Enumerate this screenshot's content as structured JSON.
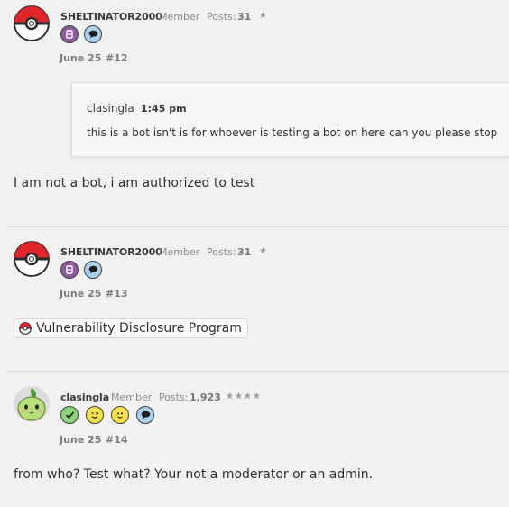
{
  "posts": [
    {
      "username": "SHELTINATOR2000",
      "role": "Member",
      "posts_label": "Posts:",
      "posts_count": "31",
      "stars": "★",
      "badges": [
        "sheltinator-badge-icon",
        "speech-bubble-badge-icon"
      ],
      "date": "June 25",
      "number": "#12",
      "quote": {
        "author": "clasingla",
        "time": "1:45 pm",
        "text": "this is a bot isn't is for whoever is testing a bot on here can you please stop"
      },
      "body": "I am not a bot, i am authorized to test"
    },
    {
      "username": "SHELTINATOR2000",
      "role": "Member",
      "posts_label": "Posts:",
      "posts_count": "31",
      "stars": "★",
      "badges": [
        "sheltinator-badge-icon",
        "speech-bubble-badge-icon"
      ],
      "date": "June 25",
      "number": "#13",
      "link": {
        "icon": "pokeball-icon",
        "label": "Vulnerability Disclosure Program"
      }
    },
    {
      "username": "clasingla",
      "role": "Member",
      "posts_label": "Posts:",
      "posts_count": "1,923",
      "stars": "★★★★",
      "badges": [
        "checkmark-badge-icon",
        "wink-face-badge-icon",
        "smile-face-badge-icon",
        "speech-bubble-badge-icon"
      ],
      "date": "June 25",
      "number": "#14",
      "body": "from who? Test what? Your not a moderator or an admin."
    }
  ],
  "colors": {
    "background": "#f1f1f1",
    "pokeball_red": "#e0262a",
    "badge_purple": "#8e5c9e",
    "badge_blue": "#a9d0ee",
    "badge_green": "#8fd37a",
    "badge_yellow": "#f5e24a"
  }
}
